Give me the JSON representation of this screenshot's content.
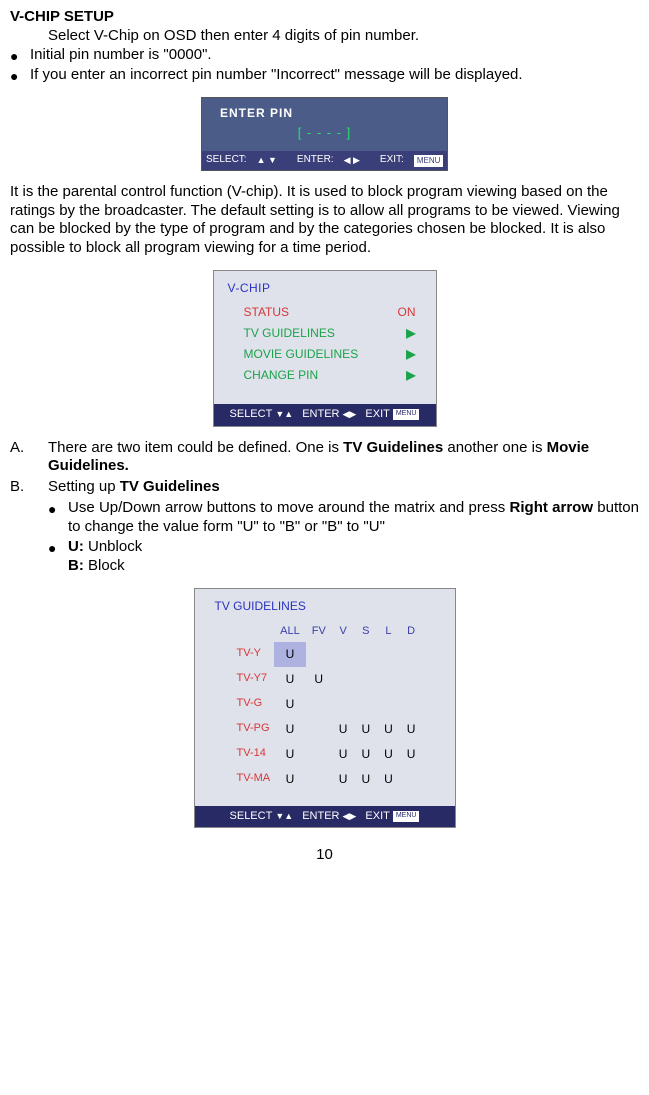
{
  "heading": "V-CHIP SETUP",
  "intro": "Select V-Chip on OSD then enter 4 digits of pin number.",
  "bullets_a": [
    "Initial pin number is \"0000\".",
    "If you enter an incorrect pin number \"Incorrect\" message will be displayed."
  ],
  "fig1": {
    "title": "ENTER PIN",
    "mask": "[ - - - - ]",
    "select": "SELECT:",
    "enter": "ENTER:",
    "exit": "EXIT:",
    "menu": "MENU"
  },
  "paragraph": "It is the parental control function (V-chip). It is used to block program viewing based on the ratings by the broadcaster. The default setting is to allow all programs to be viewed. Viewing can be blocked by the type of program and by the categories chosen be blocked. It is also possible to block all program viewing for a time period.",
  "fig2": {
    "title": "V-CHIP",
    "rows": [
      {
        "label": "STATUS",
        "value": "ON",
        "type": "red"
      },
      {
        "label": "TV GUIDELINES",
        "value": "▶",
        "type": "green"
      },
      {
        "label": "MOVIE GUIDELINES",
        "value": "▶",
        "type": "green"
      },
      {
        "label": "CHANGE PIN",
        "value": "▶",
        "type": "green"
      }
    ],
    "select": "SELECT",
    "enter": "ENTER",
    "exit": "EXIT",
    "menu": "MENU"
  },
  "items": {
    "A_pre": "There are two item could be defined. One is ",
    "A_b1": "TV Guidelines",
    "A_mid": " another one is ",
    "A_b2": "Movie Guidelines.",
    "B_pre": "Setting up ",
    "B_b1": "TV Guidelines",
    "b_bullets": {
      "one_pre": "Use Up/Down arrow buttons to move around the matrix and press ",
      "one_b": "Right arrow",
      "one_post": " button to change the value form \"U\" to \"B\" or \"B\" to  \"U\"",
      "two_b": "U:",
      "two_post": " Unblock",
      "three_b": "B:",
      "three_post": " Block"
    }
  },
  "fig3": {
    "title": "TV GUIDELINES",
    "headers": [
      "ALL",
      "FV",
      "V",
      "S",
      "L",
      "D"
    ],
    "rows": [
      {
        "label": "TV-Y",
        "cells": [
          "U",
          "",
          "",
          "",
          "",
          ""
        ],
        "hi": 0
      },
      {
        "label": "TV-Y7",
        "cells": [
          "U",
          "U",
          "",
          "",
          "",
          ""
        ],
        "hi": -1
      },
      {
        "label": "TV-G",
        "cells": [
          "U",
          "",
          "",
          "",
          "",
          ""
        ],
        "hi": -1
      },
      {
        "label": "TV-PG",
        "cells": [
          "U",
          "",
          "U",
          "U",
          "U",
          "U"
        ],
        "hi": -1
      },
      {
        "label": "TV-14",
        "cells": [
          "U",
          "",
          "U",
          "U",
          "U",
          "U"
        ],
        "hi": -1
      },
      {
        "label": "TV-MA",
        "cells": [
          "U",
          "",
          "U",
          "U",
          "U",
          ""
        ],
        "hi": -1
      }
    ],
    "select": "SELECT",
    "enter": "ENTER",
    "exit": "EXIT",
    "menu": "MENU"
  },
  "pagenum": "10"
}
